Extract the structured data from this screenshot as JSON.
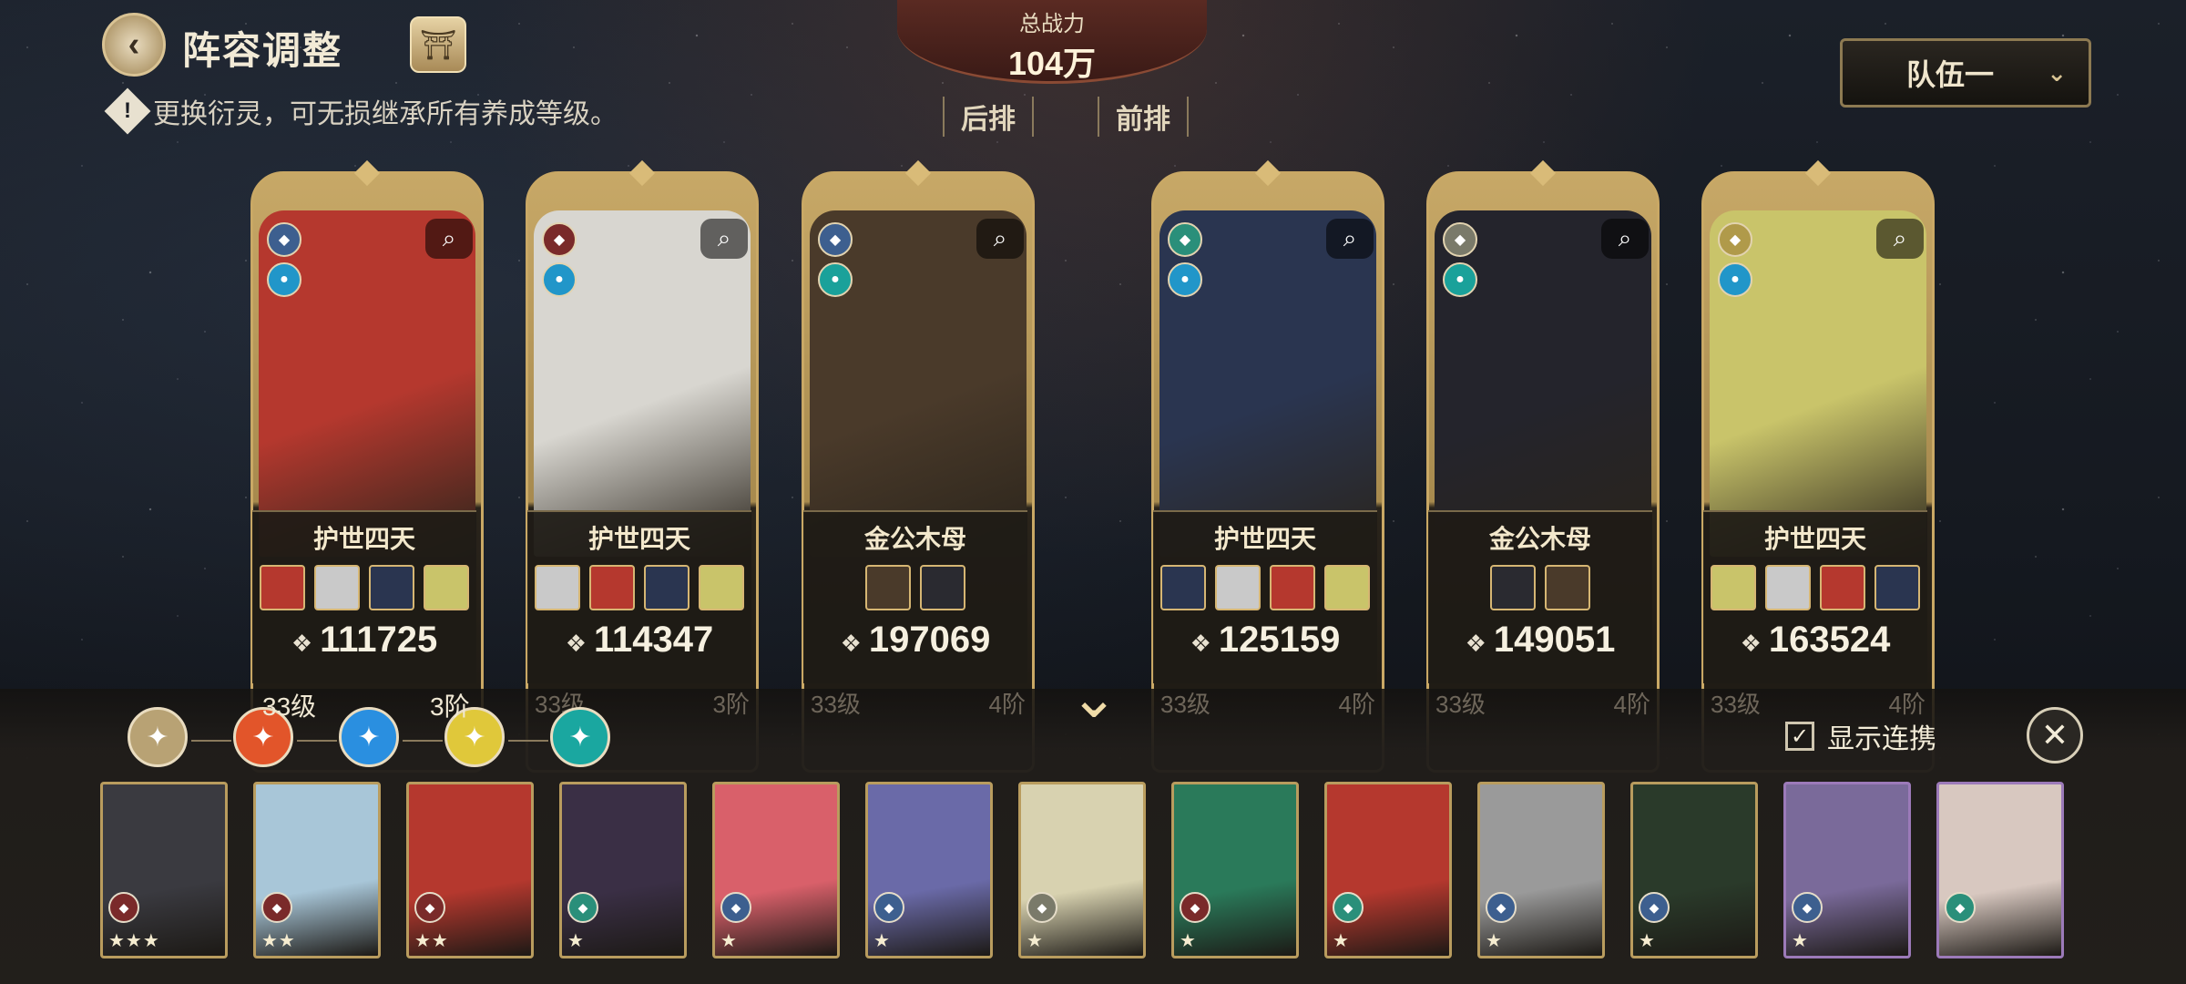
{
  "header": {
    "back_icon": "chevron-left-icon",
    "title": "阵容调整",
    "lantern_icon": "lantern-icon",
    "tip_icon": "exclamation-diamond-icon",
    "tip": "更换衍灵，可无损继承所有养成等级。"
  },
  "power": {
    "label": "总战力",
    "value": "104万"
  },
  "row_labels": {
    "back": "后排",
    "front": "前排"
  },
  "team_select": {
    "value": "队伍一",
    "icon": "chevron-down-icon"
  },
  "heroes": [
    {
      "bond": "护世四天",
      "power": "111725",
      "level": "",
      "rank": "",
      "art_color": "#b5382e",
      "role_a": "#3d5f8f",
      "role_b": "#2196c9",
      "minis": [
        "#b5382e",
        "#c9c9c9",
        "#2a3550",
        "#c9c46a"
      ]
    },
    {
      "bond": "护世四天",
      "power": "114347",
      "level": "33级",
      "rank": "3阶",
      "art_color": "#d8d6d0",
      "role_a": "#7a2a2a",
      "role_b": "#2196c9",
      "minis": [
        "#c9c9c9",
        "#b5382e",
        "#2a3550",
        "#c9c46a"
      ]
    },
    {
      "bond": "金公木母",
      "power": "197069",
      "level": "33级",
      "rank": "4阶",
      "art_color": "#4a3a2a",
      "role_a": "#3d5f8f",
      "role_b": "#1aa19a",
      "minis": [
        "#4a3a2a",
        "#2a2a30"
      ]
    },
    {
      "bond": "护世四天",
      "power": "125159",
      "level": "33级",
      "rank": "4阶",
      "art_color": "#2a3550",
      "role_a": "#2a8f7a",
      "role_b": "#2196c9",
      "minis": [
        "#2a3550",
        "#c9c9c9",
        "#b5382e",
        "#c9c46a"
      ]
    },
    {
      "bond": "金公木母",
      "power": "149051",
      "level": "33级",
      "rank": "4阶",
      "art_color": "#24242c",
      "role_a": "#7a7a6a",
      "role_b": "#1aa19a",
      "minis": [
        "#2a2a30",
        "#4a3a2a"
      ]
    },
    {
      "bond": "护世四天",
      "power": "163524",
      "level": "33级",
      "rank": "4阶",
      "art_color": "#c9c46a",
      "role_a": "#b09a4a",
      "role_b": "#2196c9",
      "minis": [
        "#c9c46a",
        "#c9c9c9",
        "#b5382e",
        "#2a3550"
      ]
    }
  ],
  "filters": {
    "level_label": "33级",
    "rank_label": "3阶",
    "items": [
      {
        "icon": "all-filter-icon",
        "color": "#b8a274"
      },
      {
        "icon": "fire-element-icon",
        "color": "#e2552a"
      },
      {
        "icon": "water-element-icon",
        "color": "#2a8fe0"
      },
      {
        "icon": "lotus-element-icon",
        "color": "#e0c83a"
      },
      {
        "icon": "spirit-element-icon",
        "color": "#1aa7a0"
      }
    ]
  },
  "show_links": {
    "label": "显示连携",
    "checked": true
  },
  "close_icon": "close-icon",
  "roster": [
    {
      "color": "#3a3a40",
      "role": "#7a2a2a",
      "stars": "★★★",
      "frame": "gold"
    },
    {
      "color": "#a8c6d8",
      "role": "#7a2a2a",
      "stars": "★★",
      "frame": "gold"
    },
    {
      "color": "#b5382e",
      "role": "#7a2a2a",
      "stars": "★★",
      "frame": "gold"
    },
    {
      "color": "#3a2f45",
      "role": "#2a8f7a",
      "stars": "★",
      "frame": "gold"
    },
    {
      "color": "#d9606a",
      "role": "#3d5f8f",
      "stars": "★",
      "frame": "gold"
    },
    {
      "color": "#6a6aa8",
      "role": "#3d5f8f",
      "stars": "★",
      "frame": "gold"
    },
    {
      "color": "#d8d2b0",
      "role": "#7a7a6a",
      "stars": "★",
      "frame": "gold"
    },
    {
      "color": "#2a7a5a",
      "role": "#7a2a2a",
      "stars": "★",
      "frame": "gold"
    },
    {
      "color": "#b5382e",
      "role": "#2a8f7a",
      "stars": "★",
      "frame": "gold"
    },
    {
      "color": "#9a9a9a",
      "role": "#3d5f8f",
      "stars": "★",
      "frame": "gold"
    },
    {
      "color": "#2a3a2a",
      "role": "#3d5f8f",
      "stars": "★",
      "frame": "gold"
    },
    {
      "color": "#7a6a9a",
      "role": "#3d5f8f",
      "stars": "★",
      "frame": "purple"
    },
    {
      "color": "#d8c8c0",
      "role": "#2a8f7a",
      "stars": "",
      "frame": "purple"
    }
  ]
}
